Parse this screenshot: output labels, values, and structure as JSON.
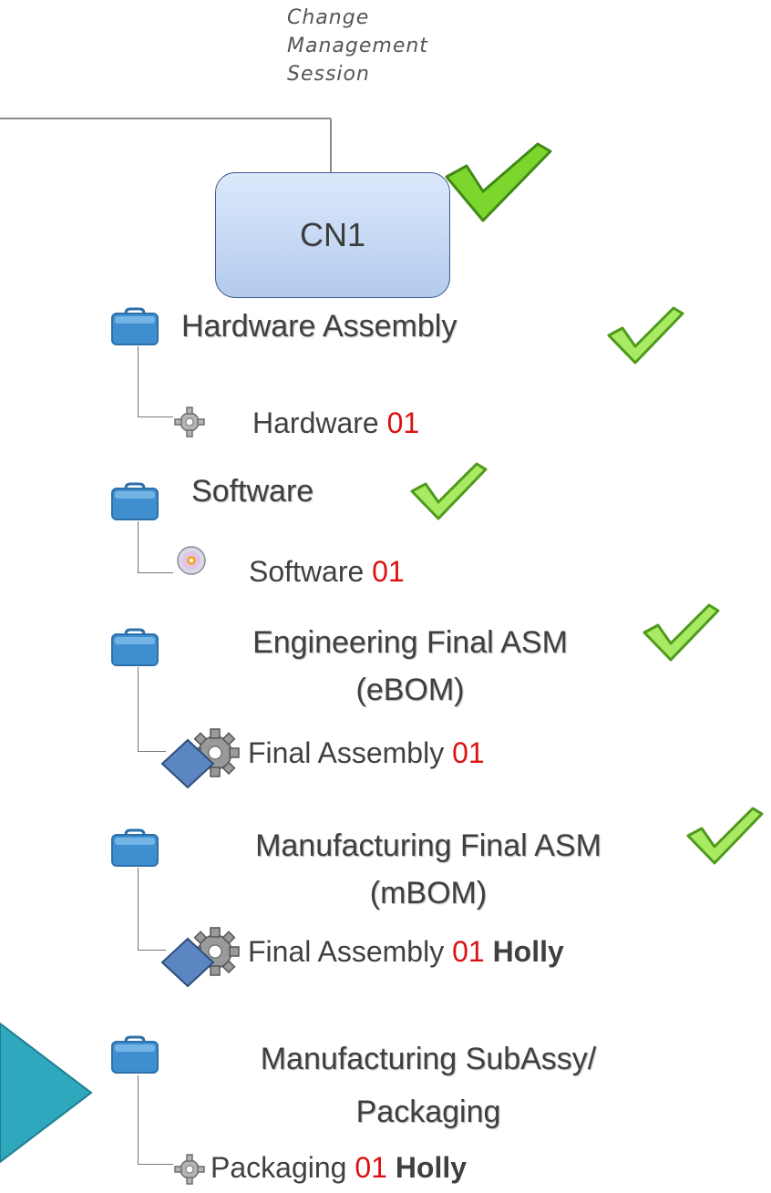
{
  "session_label": [
    "Change",
    "Management",
    "Session"
  ],
  "cn_box": {
    "label": "CN1"
  },
  "groups": [
    {
      "heading": [
        "Hardware Assembly"
      ],
      "item": {
        "name": "Hardware",
        "rev": "01",
        "owner": ""
      },
      "icon": "gear-icon",
      "checked": true
    },
    {
      "heading": [
        "Software"
      ],
      "item": {
        "name": "Software",
        "rev": "01",
        "owner": ""
      },
      "icon": "cd-icon",
      "checked": true
    },
    {
      "heading": [
        "Engineering Final ASM",
        "(eBOM)"
      ],
      "item": {
        "name": "Final Assembly",
        "rev": "01",
        "owner": ""
      },
      "icon": "assembly-icon",
      "checked": true
    },
    {
      "heading": [
        "Manufacturing Final ASM",
        "(mBOM)"
      ],
      "item": {
        "name": "Final Assembly",
        "rev": "01",
        "owner": "Holly"
      },
      "icon": "assembly-icon",
      "checked": true
    },
    {
      "heading": [
        "Manufacturing SubAssy/",
        "Packaging"
      ],
      "item": {
        "name": "Packaging",
        "rev": "01",
        "owner": "Holly"
      },
      "icon": "gear-icon",
      "checked": false
    }
  ],
  "colors": {
    "revision": "#dd1111",
    "check": "#7dd62e",
    "folder": "#3f8fd0",
    "pointer_arrow": "#2fa7bd",
    "cn_box_fill": "#c6d8f4"
  },
  "icons": {
    "folder": "folder-icon",
    "check": "checkmark-icon",
    "pointer": "pointer-arrow"
  }
}
